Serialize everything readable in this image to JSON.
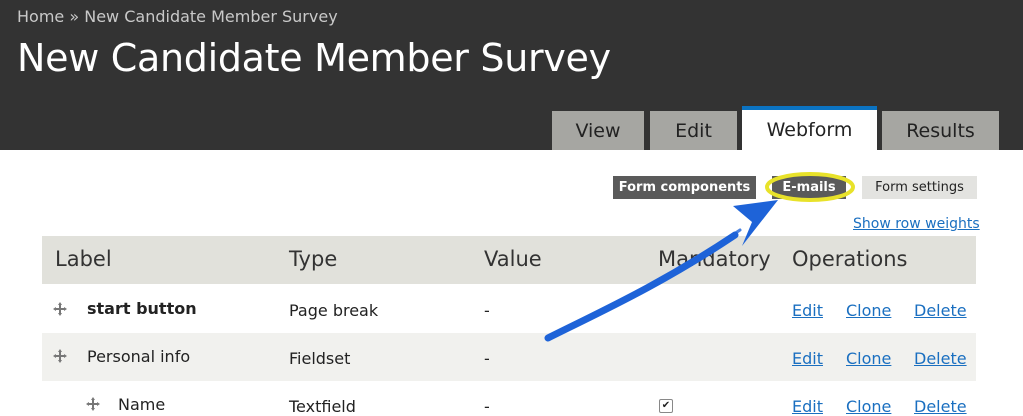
{
  "breadcrumb": {
    "home": "Home",
    "separator": "»",
    "current": "New Candidate Member Survey"
  },
  "page_title": "New Candidate Member Survey",
  "tabs": [
    {
      "label": "View",
      "active": false
    },
    {
      "label": "Edit",
      "active": false
    },
    {
      "label": "Webform",
      "active": true
    },
    {
      "label": "Results",
      "active": false
    }
  ],
  "secondary_tabs": [
    {
      "label": "Form components",
      "active": true
    },
    {
      "label": "E-mails",
      "active": false,
      "highlighted": true
    },
    {
      "label": "Form settings",
      "active": false
    }
  ],
  "show_row_weights": "Show row weights",
  "table": {
    "headers": [
      "Label",
      "Type",
      "Value",
      "Mandatory",
      "Operations"
    ],
    "rows": [
      {
        "label": "start button",
        "type": "Page break",
        "value": "-",
        "mandatory": false,
        "ops": [
          "Edit",
          "Clone",
          "Delete"
        ]
      },
      {
        "label": "Personal info",
        "type": "Fieldset",
        "value": "-",
        "mandatory": false,
        "ops": [
          "Edit",
          "Clone",
          "Delete"
        ]
      },
      {
        "label": "Name",
        "type": "Textfield",
        "value": "-",
        "mandatory": true,
        "ops": [
          "Edit",
          "Clone",
          "Delete"
        ]
      }
    ]
  },
  "colors": {
    "header_bg": "#333333",
    "tab_bg": "#a6a6a2",
    "active_tab_border": "#0b73c2",
    "link": "#1a6fc0",
    "highlight": "#e8e22a",
    "annotation_arrow": "#1e63d8"
  },
  "icons": {
    "drag_handle": "move-arrows-icon",
    "annotation": "blue-arrow-annotation"
  }
}
